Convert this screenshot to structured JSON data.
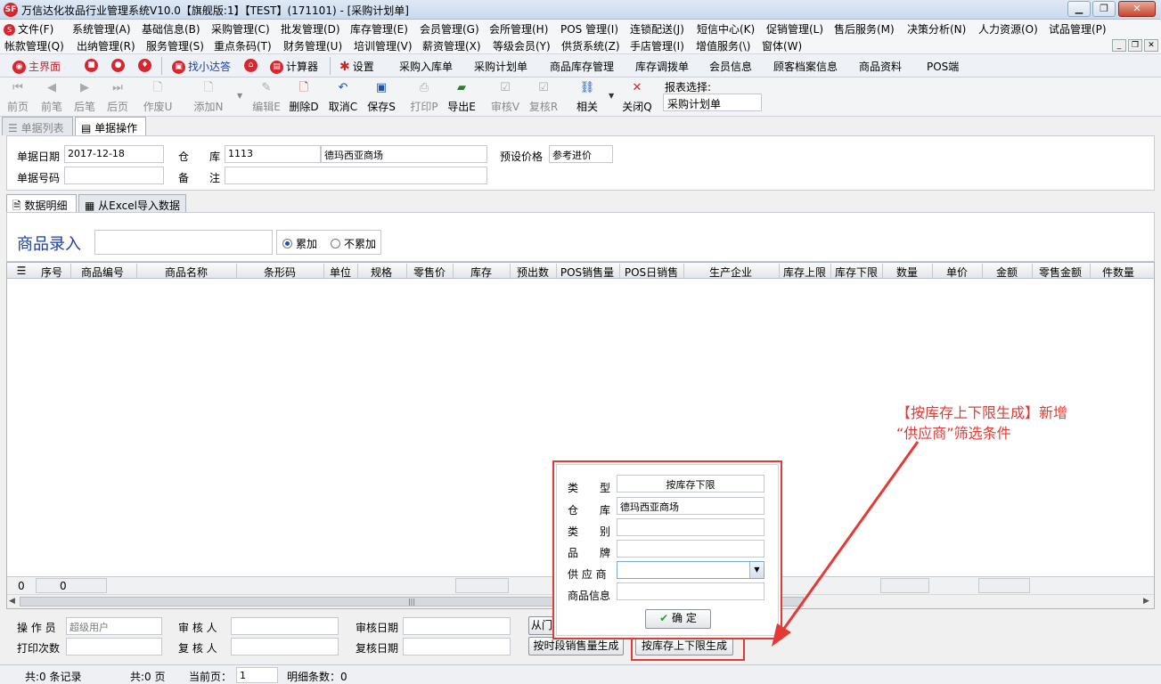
{
  "window": {
    "title": "万信达化妆品行业管理系统V10.0【旗舰版:1】【TEST】(171101) - [采购计划单]",
    "logo_text": "SF"
  },
  "menu_row1": [
    "文件(F)",
    "系统管理(A)",
    "基础信息(B)",
    "采购管理(C)",
    "批发管理(D)",
    "库存管理(E)",
    "会员管理(G)",
    "会所管理(H)",
    "POS 管理(I)",
    "连锁配送(J)",
    "短信中心(K)",
    "促销管理(L)",
    "售后服务(M)",
    "决策分析(N)",
    "人力资源(O)",
    "试品管理(P)"
  ],
  "menu_row2": [
    "帐款管理(Q)",
    "出纳管理(R)",
    "服务管理(S)",
    "重点条码(T)",
    "财务管理(U)",
    "培训管理(V)",
    "薪资管理(X)",
    "等级会员(Y)",
    "供货系统(Z)",
    "手店管理(I)",
    "增值服务(\\)",
    "窗体(W)"
  ],
  "quickbar": {
    "home": "主界面",
    "find": "找小达答",
    "calc": "计算器",
    "settings": "设置",
    "links": [
      "采购入库单",
      "采购计划单",
      "商品库存管理",
      "库存调拨单",
      "会员信息",
      "顾客档案信息",
      "商品资料",
      "POS端"
    ]
  },
  "toolbar": {
    "buttons": [
      "前页",
      "前笔",
      "后笔",
      "后页",
      "作废U",
      "添加N",
      "编辑E",
      "删除D",
      "取消C",
      "保存S",
      "打印P",
      "导出E",
      "审核V",
      "复核R",
      "相关",
      "关闭Q"
    ],
    "report_label": "报表选择:",
    "report_value": "采购计划单"
  },
  "tabs": {
    "list": "单据列表",
    "operate": "单据操作"
  },
  "form": {
    "date_label": "单据日期",
    "date_value": "2017-12-18",
    "warehouse_label1": "仓",
    "warehouse_label2": "库",
    "warehouse_code": "1113",
    "warehouse_name": "德玛西亚商场",
    "price_label": "预设价格",
    "price_value": "参考进价",
    "number_label": "单据号码",
    "number_value": "",
    "remark_label1": "备",
    "remark_label2": "注",
    "remark_value": ""
  },
  "subtabs": {
    "detail": "数据明细",
    "excel": "从Excel导入数据"
  },
  "entry": {
    "label": "商品录入",
    "radio_accumulate": "累加",
    "radio_no_accumulate": "不累加"
  },
  "grid": {
    "columns": [
      "序号",
      "商品编号",
      "商品名称",
      "条形码",
      "单位",
      "规格",
      "零售价",
      "库存",
      "预出数",
      "POS销售量",
      "POS日销售",
      "生产企业",
      "库存上限",
      "库存下限",
      "数量",
      "单价",
      "金额",
      "零售金额",
      "件数量"
    ],
    "footer_a": "0",
    "footer_b": "0"
  },
  "bottom": {
    "operator_label": "操 作 员",
    "operator_value": "超级用户",
    "reviewer_label": "审 核 人",
    "review_date_label": "审核日期",
    "print_count_label": "打印次数",
    "rechecker_label": "复 核 人",
    "recheck_date_label": "复核日期",
    "btn_from_store": "从门",
    "btn_by_period": "按时段销售量生成",
    "btn_by_stock_limit": "按库存上下限生成"
  },
  "statusbar": {
    "records": "共:0 条记录",
    "pages": "共:0 页",
    "current_page_label": "当前页：",
    "current_page_value": "1",
    "detail_count": "明细条数：0"
  },
  "popup": {
    "type_label": [
      "类",
      "型"
    ],
    "type_value": "按库存下限",
    "warehouse_label": [
      "仓",
      "库"
    ],
    "warehouse_value": "德玛西亚商场",
    "category_label": [
      "类",
      "别"
    ],
    "brand_label": [
      "品",
      "牌"
    ],
    "supplier_label": "供 应 商",
    "product_info_label": "商品信息",
    "confirm": "确 定"
  },
  "annotation": {
    "line1": "【按库存上下限生成】新增",
    "line2": "“供应商”筛选条件",
    "color": "#e53935"
  }
}
